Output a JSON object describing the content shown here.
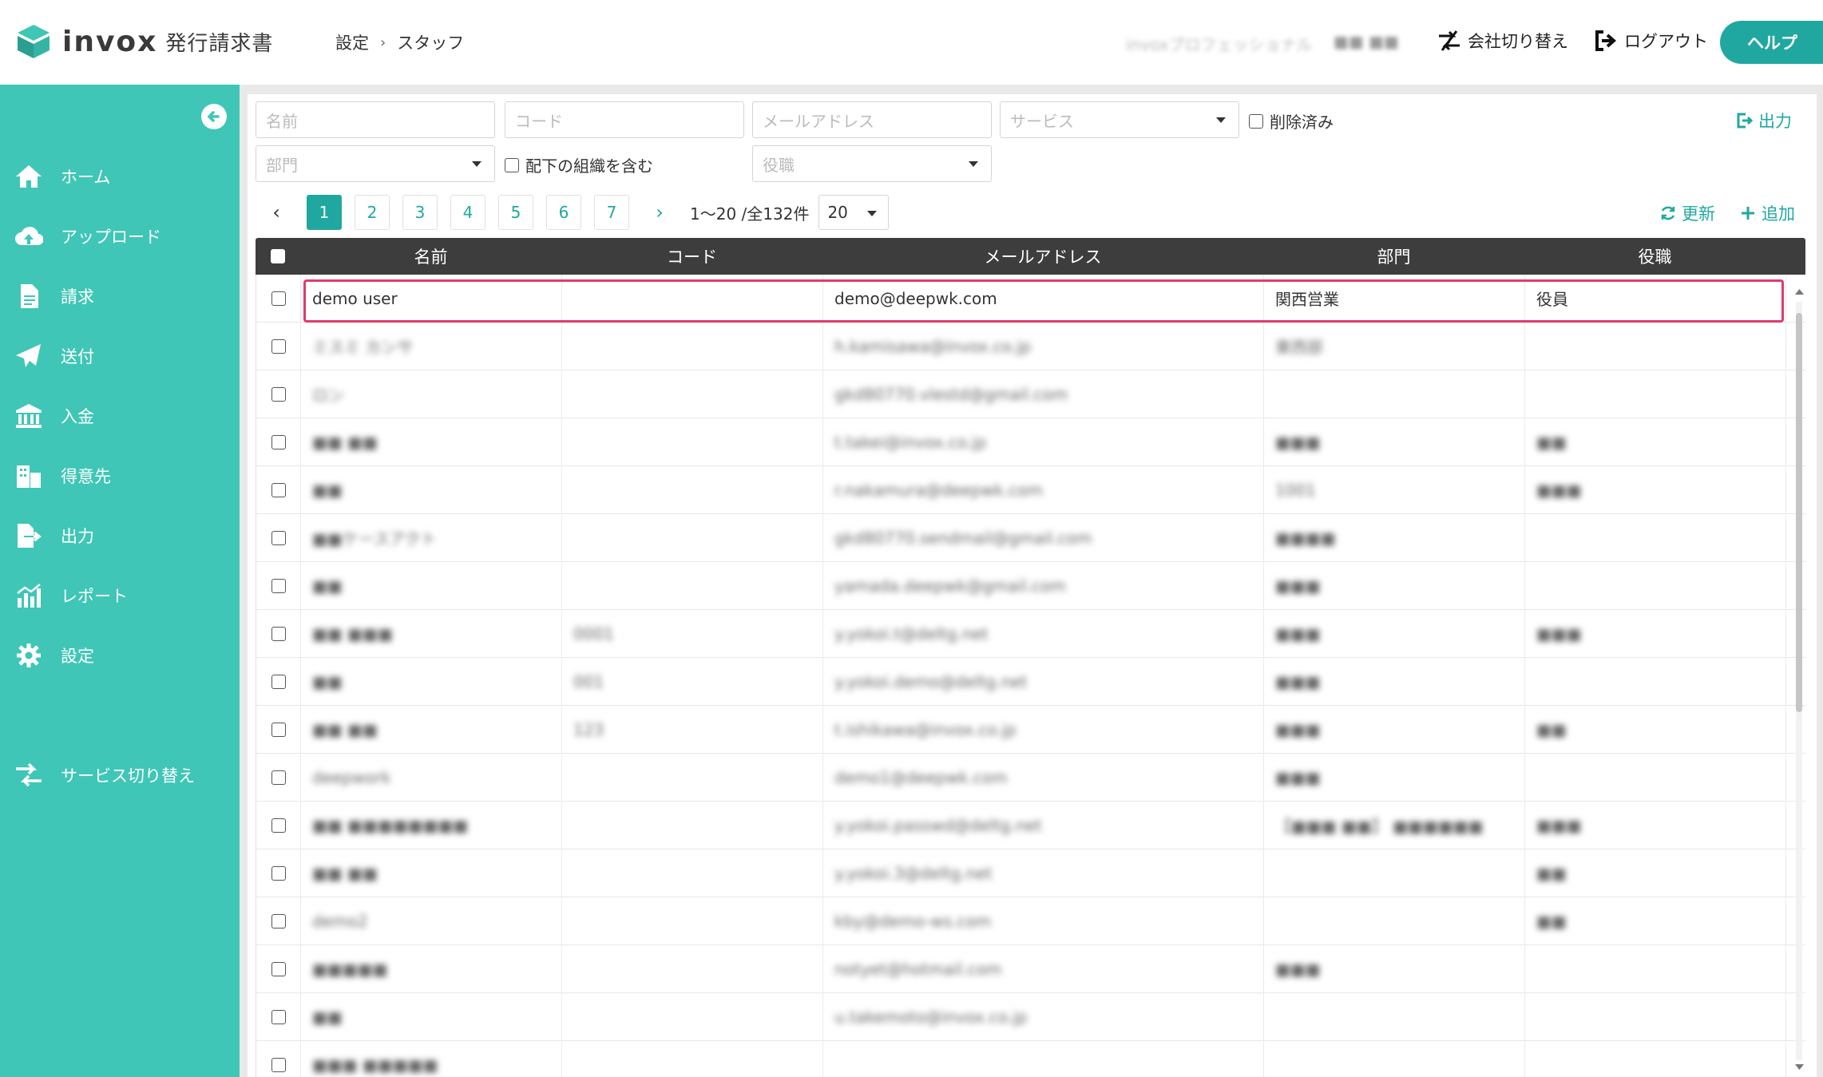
{
  "header": {
    "logo_word": "invox",
    "logo_sub": "発行請求書",
    "breadcrumb": [
      "設定",
      "スタッフ"
    ],
    "user_plan": "invoxプロフェッショナル",
    "user_name": "■■ ■■",
    "switch_company": "会社切り替え",
    "logout": "ログアウト",
    "help": "ヘルプ"
  },
  "sidebar": {
    "items": [
      {
        "label": "ホーム",
        "icon": "home-icon"
      },
      {
        "label": "アップロード",
        "icon": "cloud-upload-icon"
      },
      {
        "label": "請求",
        "icon": "document-icon"
      },
      {
        "label": "送付",
        "icon": "paper-plane-icon"
      },
      {
        "label": "入金",
        "icon": "bank-icon"
      },
      {
        "label": "得意先",
        "icon": "building-icon"
      },
      {
        "label": "出力",
        "icon": "file-export-icon"
      },
      {
        "label": "レポート",
        "icon": "chart-icon"
      },
      {
        "label": "設定",
        "icon": "gear-icon"
      }
    ],
    "service_switch": "サービス切り替え"
  },
  "filters": {
    "name_placeholder": "名前",
    "code_placeholder": "コード",
    "email_placeholder": "メールアドレス",
    "service_placeholder": "サービス",
    "deleted_label": "削除済み",
    "dept_placeholder": "部門",
    "include_sub_label": "配下の組織を含む",
    "role_placeholder": "役職",
    "export_label": "出力"
  },
  "pager": {
    "pages": [
      "1",
      "2",
      "3",
      "4",
      "5",
      "6",
      "7"
    ],
    "active": "1",
    "info": "1〜20 /全132件",
    "page_size": "20",
    "refresh_label": "更新",
    "add_label": "追加"
  },
  "table": {
    "columns": [
      "名前",
      "コード",
      "メールアドレス",
      "部門",
      "役職"
    ],
    "rows": [
      {
        "name": "demo user",
        "code": "",
        "email": "demo@deepwk.com",
        "dept": "関西営業",
        "role": "役員",
        "blur": false
      },
      {
        "name": "ミスミ カンサ",
        "code": "",
        "email": "h.kamisawa@invox.co.jp",
        "dept": "東西部",
        "role": "",
        "blur": true
      },
      {
        "name": "ロン",
        "code": "",
        "email": "gkd80770.vlestd@gmail.com",
        "dept": "",
        "role": "",
        "blur": true
      },
      {
        "name": "■■ ■■",
        "code": "",
        "email": "t.takei@invox.co.jp",
        "dept": "■■■",
        "role": "■■",
        "blur": true
      },
      {
        "name": "■■",
        "code": "",
        "email": "r.nakamura@deepwk.com",
        "dept": "1001",
        "role": "■■■",
        "blur": true
      },
      {
        "name": "■■ケースアクト",
        "code": "",
        "email": "gkd80770.sendmail@gmail.com",
        "dept": "■■■■",
        "role": "",
        "blur": true
      },
      {
        "name": "■■",
        "code": "",
        "email": "yamada.deepwk@gmail.com",
        "dept": "■■■",
        "role": "",
        "blur": true
      },
      {
        "name": "■■ ■■■",
        "code": "0001",
        "email": "y.yokoi.t@deltg.net",
        "dept": "■■■",
        "role": "■■■",
        "blur": true
      },
      {
        "name": "■■",
        "code": "001",
        "email": "y.yokoi.demo@deltg.net",
        "dept": "■■■",
        "role": "",
        "blur": true
      },
      {
        "name": "■■ ■■",
        "code": "123",
        "email": "t.ishikawa@invox.co.jp",
        "dept": "■■■",
        "role": "■■",
        "blur": true
      },
      {
        "name": "deepwork",
        "code": "",
        "email": "demo1@deepwk.com",
        "dept": "■■■",
        "role": "",
        "blur": true
      },
      {
        "name": "■■ ■■■■■■■■",
        "code": "",
        "email": "y.yokoi.passwd@deltg.net",
        "dept": "【■■■ ■■】 ■■■■■■",
        "role": "■■■",
        "blur": true
      },
      {
        "name": "■■ ■■",
        "code": "",
        "email": "y.yokoi.3@deltg.net",
        "dept": "",
        "role": "■■",
        "blur": true
      },
      {
        "name": "demo2",
        "code": "",
        "email": "kby@demo-ws.com",
        "dept": "",
        "role": "■■",
        "blur": true
      },
      {
        "name": "■■■■■",
        "code": "",
        "email": "notyet@hotmail.com",
        "dept": "■■■",
        "role": "",
        "blur": true
      },
      {
        "name": "■■",
        "code": "",
        "email": "u.takemoto@invox.co.jp",
        "dept": "",
        "role": "",
        "blur": true
      },
      {
        "name": "■■■ ■■■■■",
        "code": "",
        "email": "",
        "dept": "",
        "role": "",
        "blur": true
      }
    ]
  },
  "colors": {
    "sidebar": "#3fc6b6",
    "accent": "#20a8a0",
    "table_header": "#3d3d3d",
    "highlight": "#e03a6c"
  }
}
